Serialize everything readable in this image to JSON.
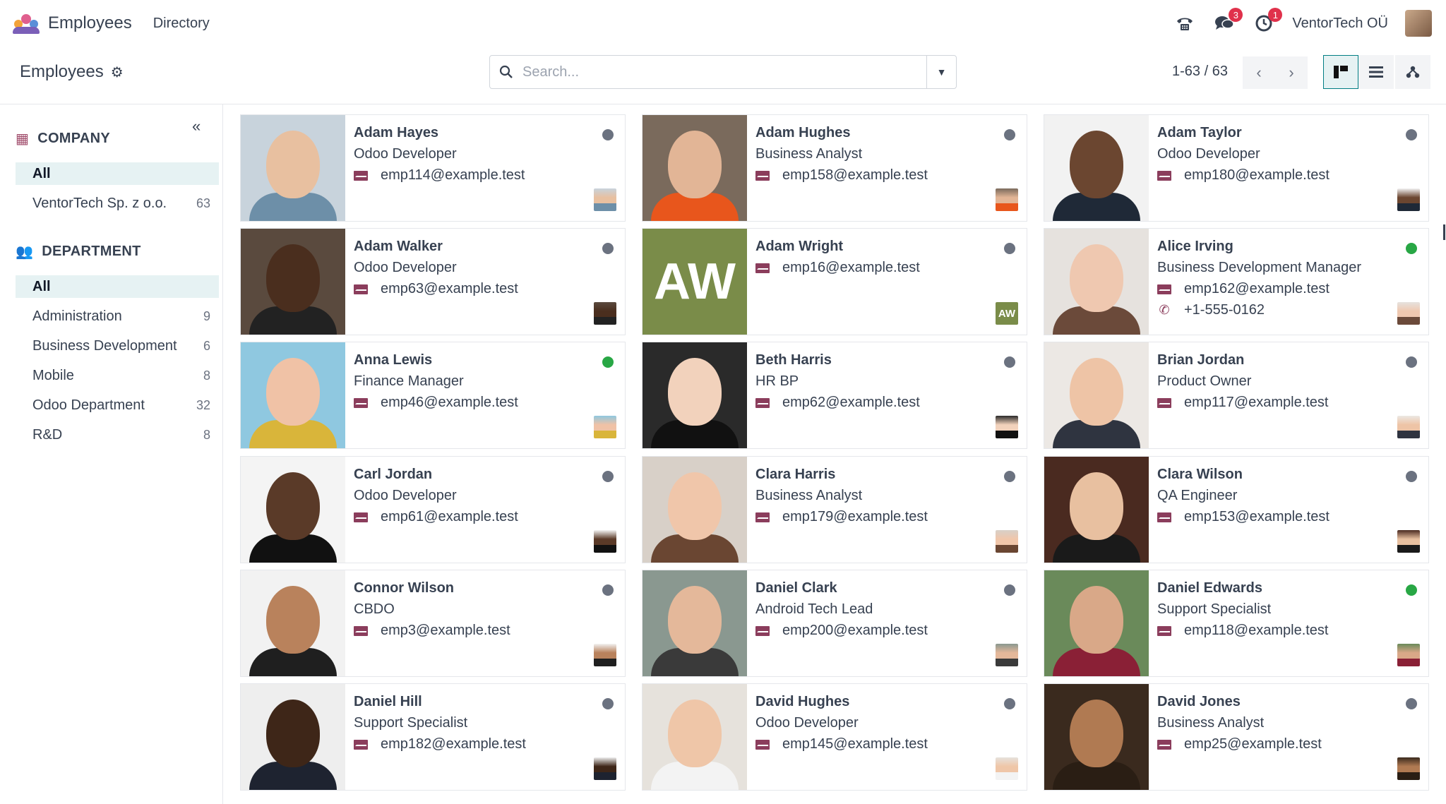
{
  "navbar": {
    "app_name": "Employees",
    "menu_directory": "Directory",
    "phone_icon": "phone-icon",
    "messages_count": "3",
    "activities_count": "1",
    "company": "VentorTech OÜ"
  },
  "control": {
    "breadcrumb": "Employees",
    "search_placeholder": "Search...",
    "pager": "1-63 / 63"
  },
  "sidebar": {
    "company_title": "COMPANY",
    "company_items": [
      {
        "label": "All",
        "count": ""
      },
      {
        "label": "VentorTech Sp. z o.o.",
        "count": "63"
      }
    ],
    "department_title": "DEPARTMENT",
    "department_items": [
      {
        "label": "All",
        "count": ""
      },
      {
        "label": "Administration",
        "count": "9"
      },
      {
        "label": "Business Development",
        "count": "6"
      },
      {
        "label": "Mobile",
        "count": "8"
      },
      {
        "label": "Odoo Department",
        "count": "32"
      },
      {
        "label": "R&D",
        "count": "8"
      }
    ]
  },
  "employees": [
    {
      "name": "Adam Hayes",
      "job": "Odoo Developer",
      "email": "emp114@example.test",
      "phone": "",
      "status": "offline",
      "bg": "#c8d3dc",
      "skin": "#e8c0a0",
      "cloth": "#6d8fa8"
    },
    {
      "name": "Adam Hughes",
      "job": "Business Analyst",
      "email": "emp158@example.test",
      "phone": "",
      "status": "offline",
      "bg": "#7a6a5c",
      "skin": "#e2b596",
      "cloth": "#e8561c"
    },
    {
      "name": "Adam Taylor",
      "job": "Odoo Developer",
      "email": "emp180@example.test",
      "phone": "",
      "status": "offline",
      "bg": "#f2f2f2",
      "skin": "#6b4630",
      "cloth": "#1f2937"
    },
    {
      "name": "Adam Walker",
      "job": "Odoo Developer",
      "email": "emp63@example.test",
      "phone": "",
      "status": "offline",
      "bg": "#5a4a3e",
      "skin": "#4a2e1e",
      "cloth": "#222222"
    },
    {
      "name": "Adam Wright",
      "job": "",
      "email": "emp16@example.test",
      "phone": "",
      "status": "offline",
      "initials": "AW",
      "bg": "#7a8c49"
    },
    {
      "name": "Alice Irving",
      "job": "Business Development Manager",
      "email": "emp162@example.test",
      "phone": "+1-555-0162",
      "status": "online",
      "bg": "#e6e2de",
      "skin": "#efc8b0",
      "cloth": "#6b4a3a"
    },
    {
      "name": "Anna Lewis",
      "job": "Finance Manager",
      "email": "emp46@example.test",
      "phone": "",
      "status": "online",
      "bg": "#8fc8e0",
      "skin": "#f0c2a6",
      "cloth": "#d9b53a"
    },
    {
      "name": "Beth Harris",
      "job": "HR BP",
      "email": "emp62@example.test",
      "phone": "",
      "status": "offline",
      "bg": "#2a2a2a",
      "skin": "#f2d2bc",
      "cloth": "#111111"
    },
    {
      "name": "Brian Jordan",
      "job": "Product Owner",
      "email": "emp117@example.test",
      "phone": "",
      "status": "offline",
      "bg": "#ece8e4",
      "skin": "#eec4a6",
      "cloth": "#2f3440"
    },
    {
      "name": "Carl Jordan",
      "job": "Odoo Developer",
      "email": "emp61@example.test",
      "phone": "",
      "status": "offline",
      "bg": "#f4f4f4",
      "skin": "#5a3a28",
      "cloth": "#111111"
    },
    {
      "name": "Clara Harris",
      "job": "Business Analyst",
      "email": "emp179@example.test",
      "phone": "",
      "status": "offline",
      "bg": "#d8d0c8",
      "skin": "#f0c6aa",
      "cloth": "#6a4632"
    },
    {
      "name": "Clara Wilson",
      "job": "QA Engineer",
      "email": "emp153@example.test",
      "phone": "",
      "status": "offline",
      "bg": "#4a2a20",
      "skin": "#e8c0a0",
      "cloth": "#1a1a1a"
    },
    {
      "name": "Connor Wilson",
      "job": "CBDO",
      "email": "emp3@example.test",
      "phone": "",
      "status": "offline",
      "bg": "#f2f2f2",
      "skin": "#b9825c",
      "cloth": "#1f1f1f"
    },
    {
      "name": "Daniel Clark",
      "job": "Android Tech Lead",
      "email": "emp200@example.test",
      "phone": "",
      "status": "offline",
      "bg": "#8a9890",
      "skin": "#e4b89a",
      "cloth": "#3a3a3a"
    },
    {
      "name": "Daniel Edwards",
      "job": "Support Specialist",
      "email": "emp118@example.test",
      "phone": "",
      "status": "online",
      "bg": "#6a8a5a",
      "skin": "#d9a888",
      "cloth": "#8a2036"
    },
    {
      "name": "Daniel Hill",
      "job": "Support Specialist",
      "email": "emp182@example.test",
      "phone": "",
      "status": "offline",
      "bg": "#eeeeee",
      "skin": "#3e2618",
      "cloth": "#1e2330"
    },
    {
      "name": "David Hughes",
      "job": "Odoo Developer",
      "email": "emp145@example.test",
      "phone": "",
      "status": "offline",
      "bg": "#e6e2dc",
      "skin": "#efc6a8",
      "cloth": "#f3f3f3"
    },
    {
      "name": "David Jones",
      "job": "Business Analyst",
      "email": "emp25@example.test",
      "phone": "",
      "status": "offline",
      "bg": "#3a2a1e",
      "skin": "#b07a52",
      "cloth": "#2a1e14"
    }
  ]
}
